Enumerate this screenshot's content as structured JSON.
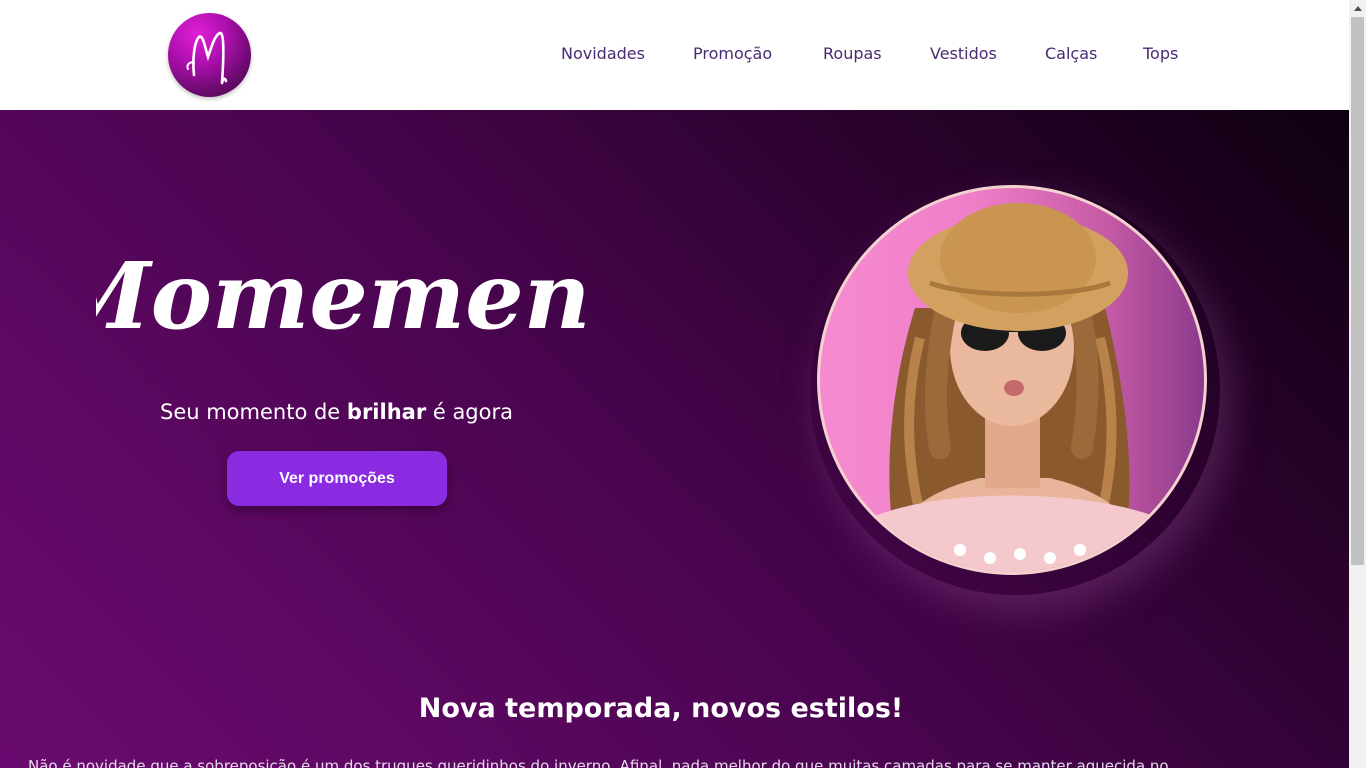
{
  "header": {
    "logo_icon": "script-m-logo",
    "nav": [
      {
        "label": "Novidades"
      },
      {
        "label": "Promoção"
      },
      {
        "label": "Roupas"
      },
      {
        "label": "Vestidos"
      },
      {
        "label": "Calças"
      },
      {
        "label": "Tops"
      }
    ],
    "nav_color": "#4a2a72"
  },
  "hero": {
    "brand_name": "Momement",
    "tagline_prefix": "Seu momento de ",
    "tagline_bold": "brilhar",
    "tagline_suffix": " é agora",
    "cta_label": "Ver promoções",
    "cta_color": "#8a2be2",
    "photo_icon": "model-portrait-image",
    "bg_colors": [
      "#0e0010",
      "#6a0a70"
    ]
  },
  "section": {
    "title": "Nova temporada, novos estilos!",
    "text": "Não é novidade que a sobreposição é um dos truques queridinhos do inverno. Afinal, nada melhor do que muitas camadas para se manter aquecida no"
  }
}
